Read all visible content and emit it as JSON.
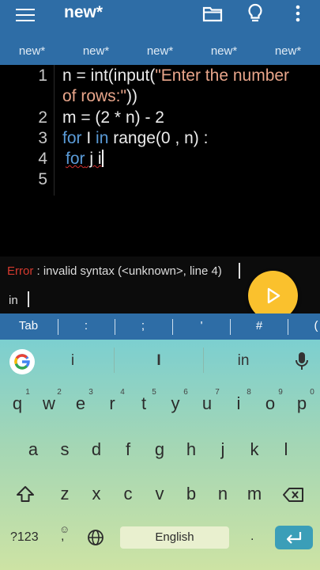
{
  "appbar": {
    "title": "new*",
    "icons": [
      "menu-icon",
      "folder-icon",
      "lightbulb-icon",
      "more-vert-icon"
    ]
  },
  "tabs": [
    "new*",
    "new*",
    "new*",
    "new*",
    "new*"
  ],
  "editor": {
    "line_numbers": [
      "1",
      "",
      "2",
      "3",
      "4",
      "5"
    ],
    "line1_a": "n = int(input(",
    "line1_b": "\"Enter the number",
    "line1_c": "of rows:\"",
    "line1_d": "))",
    "line2": "m = (2 * n) - 2",
    "line3_kw1": "for",
    "line3_a": " I ",
    "line3_kw2": "in",
    "line3_b": " range(0 , n) :",
    "line4_kw": "for",
    "line4_b": " j i"
  },
  "console": {
    "error_label": "Error",
    "error_text": " : invalid syntax (<unknown>, line 4)",
    "input_text": "in"
  },
  "symbols": [
    "Tab",
    ":",
    ";",
    "'",
    "#",
    "("
  ],
  "keyboard": {
    "suggestions": [
      "i",
      "I",
      "in"
    ],
    "row1": [
      "q",
      "w",
      "e",
      "r",
      "t",
      "y",
      "u",
      "i",
      "o",
      "p"
    ],
    "row1_hints": [
      "1",
      "2",
      "3",
      "4",
      "5",
      "6",
      "7",
      "8",
      "9",
      "0"
    ],
    "row2": [
      "a",
      "s",
      "d",
      "f",
      "g",
      "h",
      "j",
      "k",
      "l"
    ],
    "row3": [
      "z",
      "x",
      "c",
      "v",
      "b",
      "n",
      "m"
    ],
    "symbols_key": "?123",
    "comma": ",",
    "period": ".",
    "space_label": "English"
  },
  "colors": {
    "appbar": "#2e6da6",
    "keyword": "#5a9bd8",
    "string": "#e8a58a",
    "error": "#d63a2f",
    "run_button": "#fac12d"
  }
}
